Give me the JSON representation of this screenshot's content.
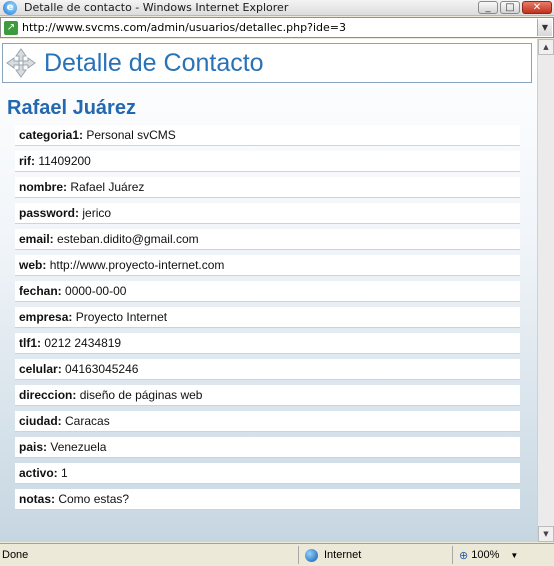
{
  "window": {
    "title": "Detalle de contacto - Windows Internet Explorer"
  },
  "address": {
    "url": "http://www.svcms.com/admin/usuarios/detallec.php?ide=3"
  },
  "page": {
    "title": "Detalle de Contacto",
    "contact_name": "Rafael Juárez",
    "fields": [
      {
        "label": "categoria1:",
        "value": "Personal svCMS"
      },
      {
        "label": "rif:",
        "value": "11409200"
      },
      {
        "label": "nombre:",
        "value": "Rafael Juárez"
      },
      {
        "label": "password:",
        "value": "jerico"
      },
      {
        "label": "email:",
        "value": "esteban.didito@gmail.com"
      },
      {
        "label": "web:",
        "value": "http://www.proyecto-internet.com"
      },
      {
        "label": "fechan:",
        "value": "0000-00-00"
      },
      {
        "label": "empresa:",
        "value": "Proyecto Internet"
      },
      {
        "label": "tlf1:",
        "value": "0212 2434819"
      },
      {
        "label": "celular:",
        "value": "04163045246"
      },
      {
        "label": "direccion:",
        "value": "diseño de páginas web"
      },
      {
        "label": "ciudad:",
        "value": "Caracas"
      },
      {
        "label": "pais:",
        "value": "Venezuela"
      },
      {
        "label": "activo:",
        "value": "1"
      },
      {
        "label": "notas:",
        "value": "Como estas?"
      }
    ]
  },
  "status": {
    "text": "Done",
    "zone": "Internet",
    "zoom": "100%"
  },
  "icons": {
    "browser": "ie-icon",
    "page": "page-icon",
    "logo": "arrows-logo-icon",
    "zone": "globe-icon",
    "zoom": "magnifier-icon"
  }
}
